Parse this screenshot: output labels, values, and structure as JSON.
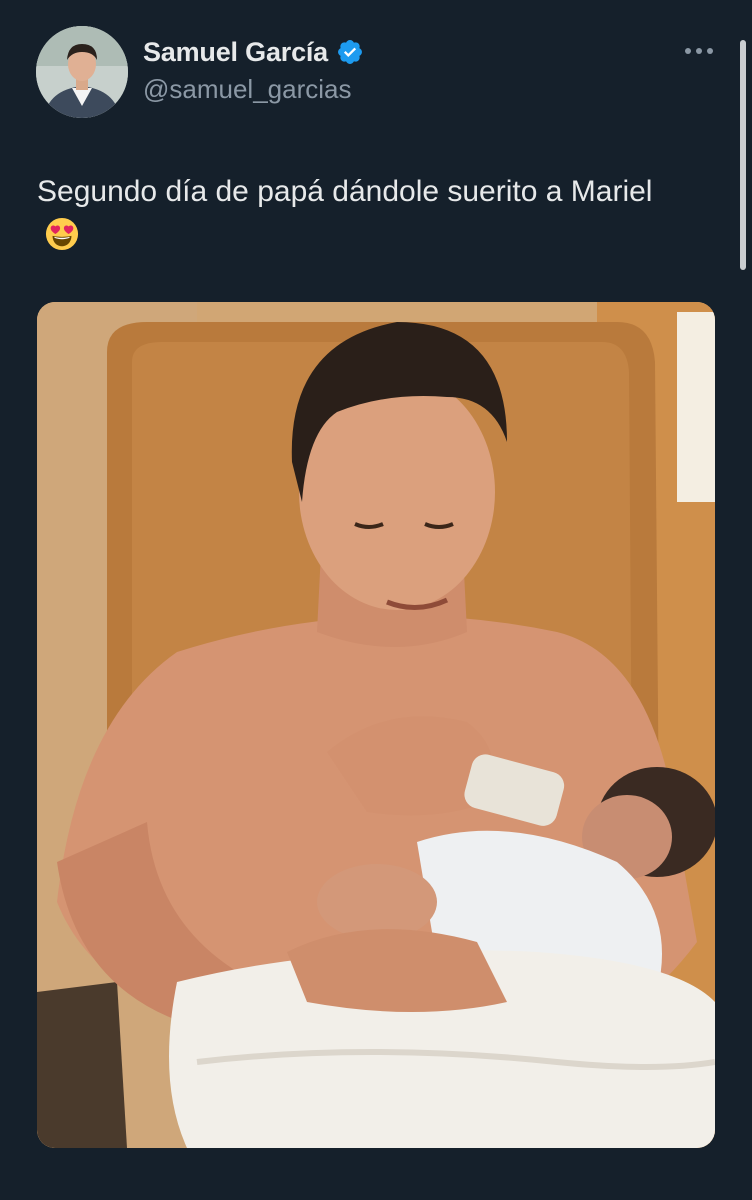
{
  "tweet": {
    "author": {
      "display_name": "Samuel García",
      "handle": "@samuel_garcias",
      "verified": true,
      "verified_color": "#1d9bf0",
      "avatar_icon": "profile-photo"
    },
    "text": "Segundo día de papá dándole suerito a Mariel",
    "text_emoji": "smiling-face-with-heart-eyes-emoji",
    "media": {
      "type": "photo",
      "icon": "photo"
    },
    "more_icon": "more-options-icon"
  },
  "theme": {
    "background": "#15202b",
    "primary_text": "#e7e9ea",
    "secondary_text": "#8b98a5"
  }
}
